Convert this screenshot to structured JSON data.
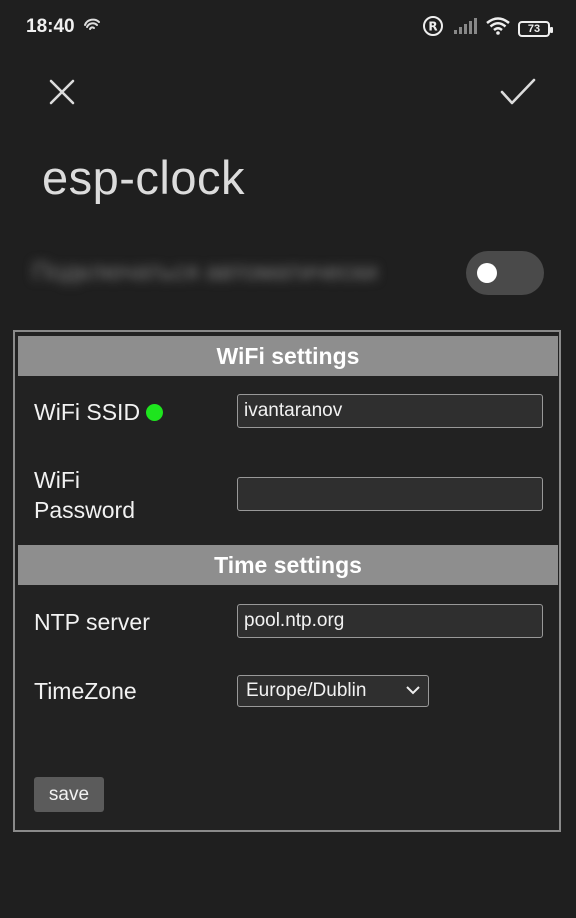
{
  "status_bar": {
    "time": "18:40",
    "battery": "73"
  },
  "toolbar": {
    "close_icon": "close-icon",
    "confirm_icon": "checkmark-icon"
  },
  "network": {
    "name": "esp-clock",
    "auto_connect_label": "Подключаться автоматически",
    "auto_connect_enabled": false
  },
  "config": {
    "wifi_section": {
      "title": "WiFi settings",
      "ssid_label": "WiFi SSID",
      "ssid_status_color": "#1ee51e",
      "ssid_value": "ivantaranov",
      "password_label_line1": "WiFi",
      "password_label_line2": "Password",
      "password_value": ""
    },
    "time_section": {
      "title": "Time settings",
      "ntp_label": "NTP server",
      "ntp_value": "pool.ntp.org",
      "timezone_label": "TimeZone",
      "timezone_value": "Europe/Dublin"
    },
    "save_label": "save"
  },
  "colors": {
    "background": "#1f1f1f",
    "section_header": "#8e8e8e",
    "status_ok": "#1ee51e"
  }
}
